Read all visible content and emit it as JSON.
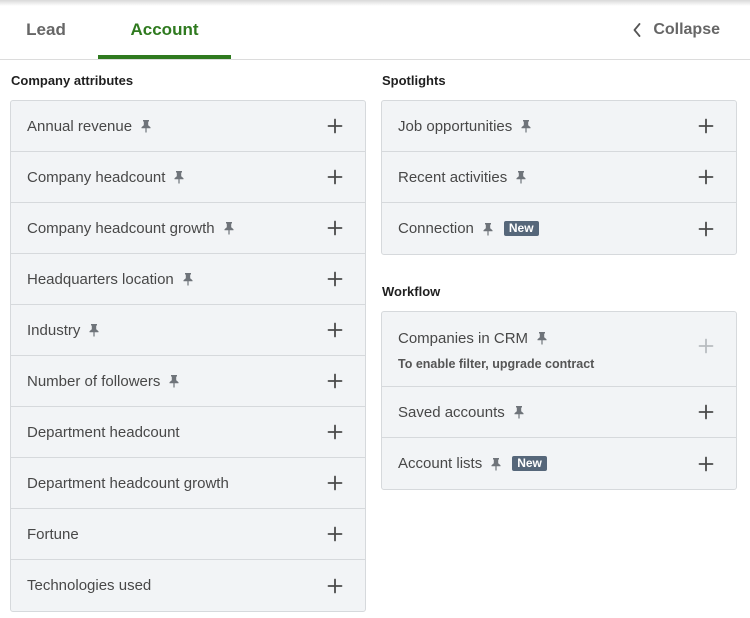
{
  "tabs": {
    "lead_label": "Lead",
    "account_label": "Account",
    "active": "Account",
    "active_color": "#2f7a1f"
  },
  "collapse": {
    "label": "Collapse",
    "icon": "chevron-left-icon"
  },
  "company_attributes": {
    "title": "Company attributes",
    "items": [
      {
        "label": "Annual revenue",
        "pinned": true
      },
      {
        "label": "Company headcount",
        "pinned": true
      },
      {
        "label": "Company headcount growth",
        "pinned": true
      },
      {
        "label": "Headquarters location",
        "pinned": true
      },
      {
        "label": "Industry",
        "pinned": true
      },
      {
        "label": "Number of followers",
        "pinned": true
      },
      {
        "label": "Department headcount",
        "pinned": false
      },
      {
        "label": "Department headcount growth",
        "pinned": false
      },
      {
        "label": "Fortune",
        "pinned": false
      },
      {
        "label": "Technologies used",
        "pinned": false
      }
    ]
  },
  "spotlights": {
    "title": "Spotlights",
    "items": [
      {
        "label": "Job opportunities",
        "pinned": true
      },
      {
        "label": "Recent activities",
        "pinned": true
      },
      {
        "label": "Connection",
        "pinned": true,
        "badge": "New"
      }
    ]
  },
  "workflow": {
    "title": "Workflow",
    "items": [
      {
        "label": "Companies in CRM",
        "pinned": true,
        "note": "To enable filter, upgrade contract",
        "disabled": true
      },
      {
        "label": "Saved accounts",
        "pinned": true
      },
      {
        "label": "Account lists",
        "pinned": true,
        "badge": "New"
      }
    ]
  },
  "colors": {
    "panel_bg": "#f2f4f6",
    "badge_bg": "#56677a",
    "border": "#d6d9dc"
  }
}
